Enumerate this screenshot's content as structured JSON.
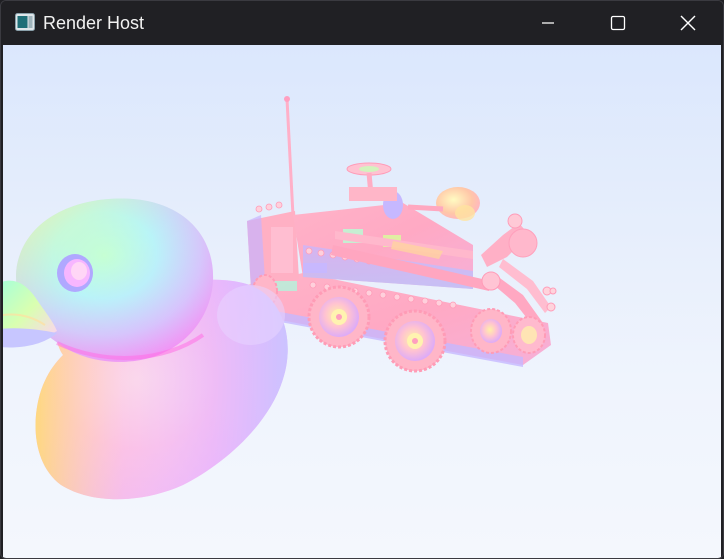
{
  "window": {
    "title": "Render Host",
    "controls": {
      "minimize_icon": "minimize-icon",
      "maximize_icon": "maximize-icon",
      "close_icon": "close-icon"
    }
  },
  "viewport": {
    "background_top": "#dbe7fd",
    "background_bottom": "#f4f7fd",
    "models": [
      "rubber-duck",
      "lego-truck"
    ]
  }
}
